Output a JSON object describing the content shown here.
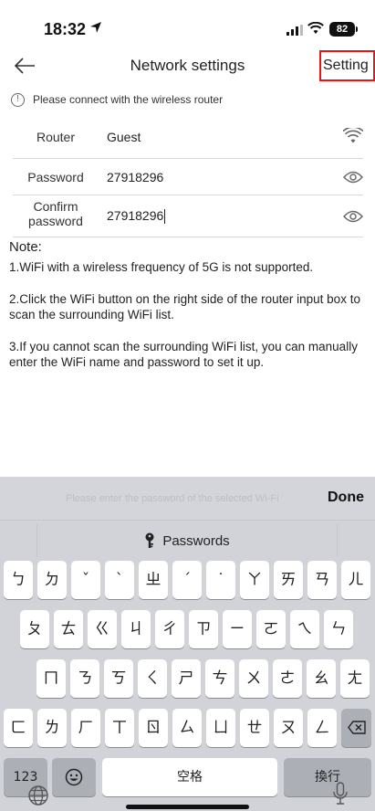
{
  "status_bar": {
    "time": "18:32",
    "battery": "82"
  },
  "nav": {
    "title": "Network settings",
    "setting_label": "Setting"
  },
  "notice": {
    "text": "Please connect with the wireless router"
  },
  "form": {
    "router": {
      "label": "Router",
      "value": "Guest"
    },
    "password": {
      "label": "Password",
      "value": "27918296"
    },
    "confirm": {
      "label_line1": "Confirm",
      "label_line2": "password",
      "value": "27918296"
    }
  },
  "notes": {
    "title": "Note:",
    "items": [
      "1.WiFi with a wireless frequency of 5G is not supported.",
      "2.Click the WiFi button on the right side of the router input box to scan the surrounding WiFi list.",
      "3.If you cannot scan the surrounding WiFi list, you can manually enter the WiFi name and password to set it up."
    ]
  },
  "keyboard": {
    "hint": "Please enter the password of the selected Wi-Fi",
    "done_label": "Done",
    "passwords_label": "Passwords",
    "row1": [
      "ㄅ",
      "ㄉ",
      "ˇ",
      "ˋ",
      "ㄓ",
      "ˊ",
      "˙",
      "ㄚ",
      "ㄞ",
      "ㄢ",
      "ㄦ"
    ],
    "row2": [
      "ㄆ",
      "ㄊ",
      "ㄍ",
      "ㄐ",
      "ㄔ",
      "ㄗ",
      "ㄧ",
      "ㄛ",
      "ㄟ",
      "ㄣ"
    ],
    "row3": [
      "ㄇ",
      "ㄋ",
      "ㄎ",
      "ㄑ",
      "ㄕ",
      "ㄘ",
      "ㄨ",
      "ㄜ",
      "ㄠ",
      "ㄤ"
    ],
    "row4": [
      "ㄈ",
      "ㄌ",
      "ㄏ",
      "ㄒ",
      "ㄖ",
      "ㄙ",
      "ㄩ",
      "ㄝ",
      "ㄡ",
      "ㄥ"
    ],
    "numbers_label": "123",
    "space_label": "空格",
    "return_label": "換行"
  }
}
